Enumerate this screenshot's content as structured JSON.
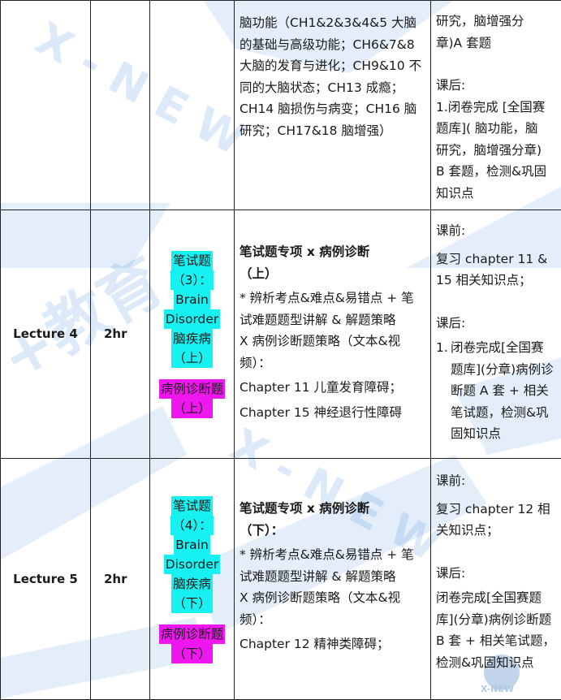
{
  "cont": {
    "content": "脑功能（CH1&2&3&4&5 大脑的基础与高级功能；CH6&7&8 大脑的发育与进化；CH9&10 不同的大脑状态；CH13 成瘾；CH14 脑损伤与病变；CH16 脑研究；CH17&18 脑增强）",
    "hw_lines": [
      "研究，脑增强分",
      "章)A 套题",
      "",
      "课后:",
      "1.闭卷完成 [全国赛",
      "题库]( 脑功能，脑",
      "研究，脑增强分章)",
      "B 套题，检测&巩固",
      "知识点"
    ]
  },
  "rows": [
    {
      "lecture": "Lecture 4",
      "duration": "2hr",
      "topic": {
        "cyan": [
          "笔试题",
          "（3）：",
          "Brain",
          "Disorder",
          "脑疾病",
          "（上）"
        ],
        "magenta": [
          "病例诊断题",
          "（上）"
        ]
      },
      "content": {
        "title": "笔试题专项 x 病例诊断",
        "subtitle": "（上）",
        "lines": [
          "* 辨析考点&难点&易错点 + 笔试难题题型讲解 & 解题策略",
          "X 病例诊断题策略（文本&视频）：",
          "Chapter 11 儿童发育障碍；",
          "Chapter 15 神经退行性障碍"
        ]
      },
      "homework": {
        "pre_label": "课前:",
        "pre": "复习 chapter 11 & 15 相关知识点；",
        "post_label": "课后:",
        "post_num": "1.",
        "post": "闭卷完成[全国赛题库](分章)病例诊断题 A 套 + 相关笔试题，检测&巩固知识点"
      }
    },
    {
      "lecture": "Lecture 5",
      "duration": "2hr",
      "topic": {
        "cyan": [
          "笔试题",
          "（4）：",
          "Brain",
          "Disorder",
          "脑疾病",
          "（下）"
        ],
        "magenta": [
          "病例诊断题",
          "（下）"
        ]
      },
      "content": {
        "title": "笔试题专项 x 病例诊断",
        "subtitle": "（下）：",
        "lines": [
          "* 辨析考点&难点&易错点 + 笔试难题题型讲解 & 解题策略",
          "X 病例诊断题策略（文本&视频）：",
          "Chapter 12 精神类障碍；"
        ]
      },
      "homework": {
        "pre_label": "课前:",
        "pre": "复习 chapter 12 相关知识点；",
        "post_label": "课后:",
        "post": "闭卷完成[全国赛题库](分章)病例诊断题 B 套 + 相关笔试题，检测&巩固知识点"
      }
    }
  ],
  "watermark": {
    "text_x_new": "X - N E W",
    "text_brand": "+教育",
    "text_corner": "X-NEW",
    "color": "#3b86d6"
  }
}
